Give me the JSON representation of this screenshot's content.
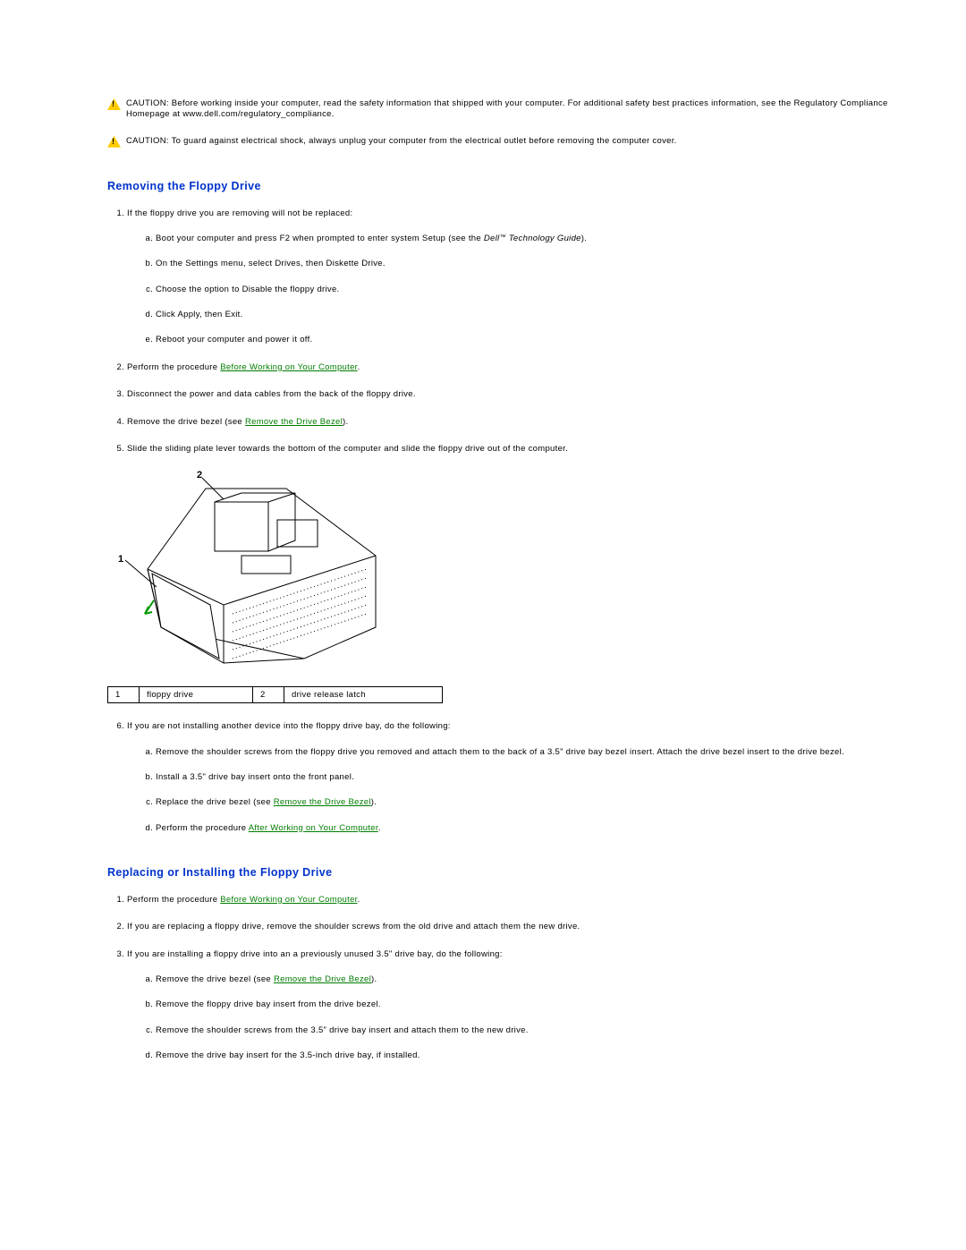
{
  "cautions": [
    {
      "prefix": "CAUTION:",
      "text": " Before working inside your computer, read the safety information that shipped with your computer. For additional safety best practices information, see the Regulatory Compliance Homepage at www.dell.com/regulatory_compliance."
    },
    {
      "prefix": "CAUTION:",
      "text": " To guard against electrical shock, always unplug your computer from the electrical outlet before removing the computer cover."
    }
  ],
  "section1": {
    "title": "Removing the Floppy Drive",
    "step1": "If the floppy drive you are removing will not be replaced:",
    "step1a_a": "Boot your computer and press F2 when prompted to enter system Setup (see the ",
    "step1a_b": "Dell",
    "step1a_tm": "™",
    "step1a_c": " Technology Guide",
    "step1a_d": ").",
    "step1b": "On the Settings menu, select Drives, then Diskette Drive.",
    "step1c": "Choose the option to Disable the floppy drive.",
    "step1d": "Click Apply, then Exit.",
    "step1e": "Reboot your computer and power it off.",
    "step2_a": "Perform the procedure ",
    "step2_link": "Before Working on Your Computer",
    "step2_b": ".",
    "step3": "Disconnect the power and data cables from the back of the floppy drive.",
    "step4_a": "Remove the drive bezel (see ",
    "step4_link": "Remove the Drive Bezel",
    "step4_b": ").",
    "step5": "Slide the sliding plate lever towards the bottom of the computer and slide the floppy drive out of the computer.",
    "table": {
      "c1n": "1",
      "c1l": "floppy drive",
      "c2n": "2",
      "c2l": "drive release latch"
    },
    "step6": "If you are not installing another device into the floppy drive bay, do the following:",
    "step6a": "Remove the shoulder screws from the floppy drive you removed and attach them to the back of a 3.5\" drive bay bezel insert. Attach the drive bezel insert to the drive bezel.",
    "step6b": "Install a 3.5\" drive bay insert onto the front panel.",
    "step6c_a": "Replace the drive bezel (see ",
    "step6c_link": "Remove the Drive Bezel",
    "step6c_b": ").",
    "step6d_a": "Perform the procedure ",
    "step6d_link": "After Working on Your Computer",
    "step6d_b": "."
  },
  "section2": {
    "title": "Replacing or Installing the Floppy Drive",
    "step1_a": "Perform the procedure ",
    "step1_link": "Before Working on Your Computer",
    "step1_b": ".",
    "step2": "If you are replacing a floppy drive, remove the shoulder screws from the old drive and attach them the new drive.",
    "step3": "If you are installing a floppy drive into an a previously unused 3.5\" drive bay, do the following:",
    "step3a_a": "Remove the drive bezel (see ",
    "step3a_link": "Remove the Drive Bezel",
    "step3a_b": ").",
    "step3b": "Remove the floppy drive bay insert from the drive bezel.",
    "step3c": "Remove the shoulder screws from the 3.5\" drive bay insert and attach them to the new drive.",
    "step3d": "Remove the drive bay insert for the 3.5-inch drive bay, if installed."
  },
  "figure": {
    "callout1": "1",
    "callout2": "2"
  }
}
